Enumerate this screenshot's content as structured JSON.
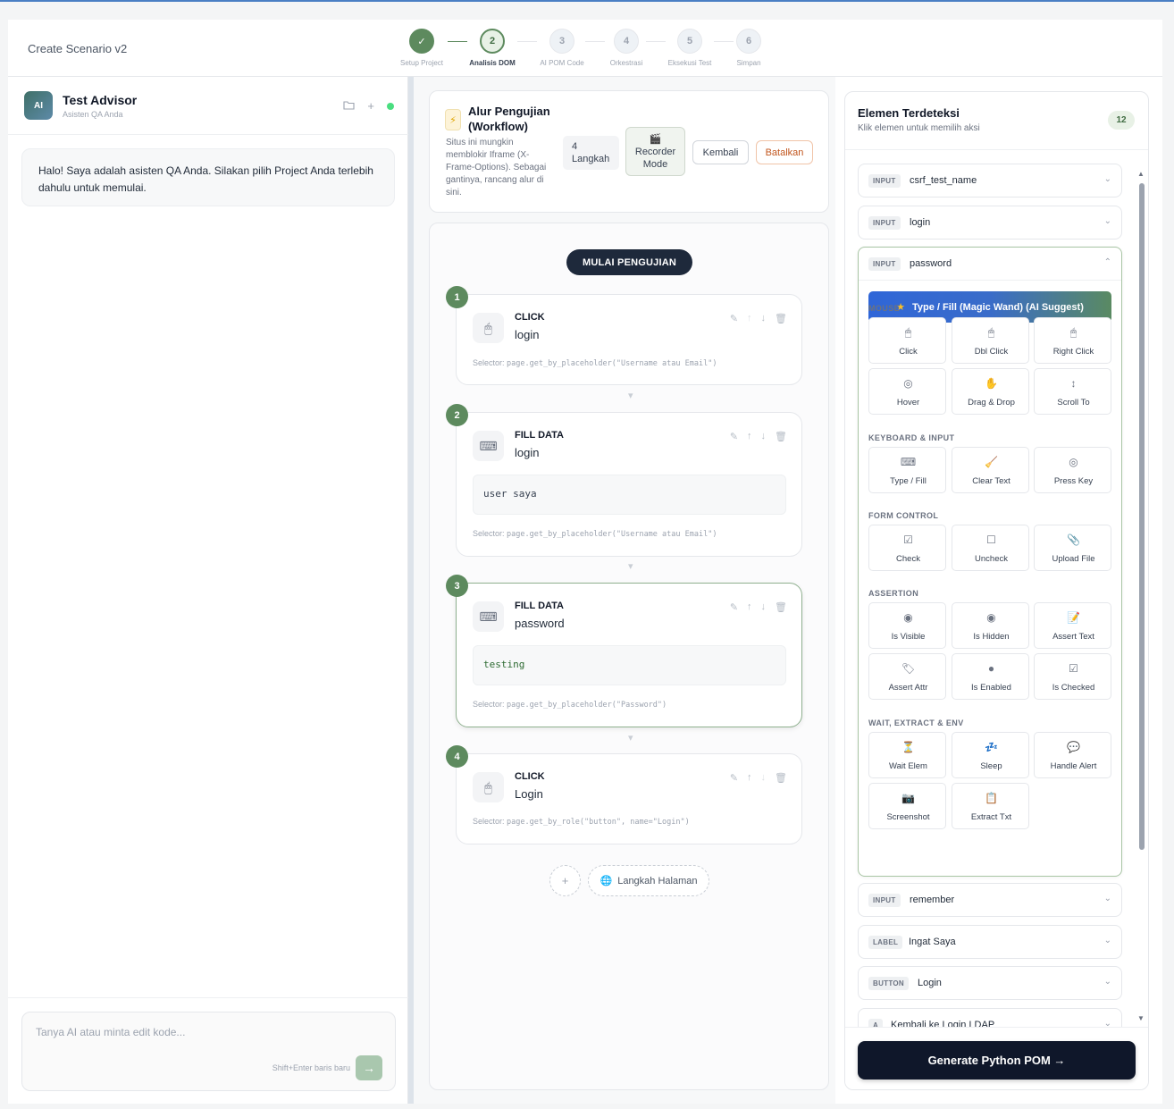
{
  "app": {
    "title": "Create Scenario v2"
  },
  "stepper": [
    {
      "num": "✓",
      "label": "Setup Project",
      "state": "done"
    },
    {
      "num": "2",
      "label": "Analisis DOM",
      "state": "active"
    },
    {
      "num": "3",
      "label": "AI POM Code",
      "state": "todo"
    },
    {
      "num": "4",
      "label": "Orkestrasi",
      "state": "todo"
    },
    {
      "num": "5",
      "label": "Eksekusi Test",
      "state": "todo"
    },
    {
      "num": "6",
      "label": "Simpan",
      "state": "todo"
    }
  ],
  "advisor": {
    "avatar": "AI",
    "name": "Test Advisor",
    "subtitle": "Asisten QA Anda",
    "icons": [
      "folder-icon",
      "plus-icon",
      "online-status-dot"
    ],
    "message": "Halo! Saya adalah asisten QA Anda. Silakan pilih Project Anda terlebih dahulu untuk memulai.",
    "input_placeholder": "Tanya AI atau minta edit kode...",
    "input_hint": "Shift+Enter baris baru"
  },
  "workflow": {
    "title": "Alur Pengujian (Workflow)",
    "description": "Situs ini mungkin memblokir Iframe (X-Frame-Options). Sebagai gantinya, rancang alur di sini.",
    "count": "4 Langkah",
    "recorder_label": "Recorder Mode",
    "back_label": "Kembali",
    "cancel_label": "Batalkan",
    "start_label": "MULAI PENGUJIAN",
    "add_page_label": "Langkah Halaman",
    "steps": [
      {
        "num": "1",
        "type": "CLICK",
        "name": "login",
        "value": null,
        "selector_prefix": "Selector:",
        "selector": "page.get_by_placeholder(\"Username atau Email\")"
      },
      {
        "num": "2",
        "type": "FILL DATA",
        "name": "login",
        "value": "user saya",
        "selector_prefix": "Selector:",
        "selector": "page.get_by_placeholder(\"Username atau Email\")"
      },
      {
        "num": "3",
        "type": "FILL DATA",
        "name": "password",
        "value": "testing",
        "selector_prefix": "Selector:",
        "selector": "page.get_by_placeholder(\"Password\")"
      },
      {
        "num": "4",
        "type": "CLICK",
        "name": "Login",
        "value": null,
        "selector_prefix": "Selector:",
        "selector": "page.get_by_role(\"button\", name=\"Login\")"
      }
    ]
  },
  "elements": {
    "title": "Elemen Terdeteksi",
    "subtitle": "Klik elemen untuk memilih aksi",
    "count": "12",
    "items": [
      {
        "tag": "INPUT",
        "name": "csrf_test_name"
      },
      {
        "tag": "INPUT",
        "name": "login"
      },
      {
        "tag": "INPUT",
        "name": "password"
      },
      {
        "tag": "INPUT",
        "name": "remember"
      },
      {
        "tag": "LABEL",
        "name": "Ingat Saya"
      },
      {
        "tag": "BUTTON",
        "name": "Login"
      },
      {
        "tag": "A",
        "name": "Kembali ke Login LDAP"
      }
    ],
    "magic_label": "Type / Fill (Magic Wand) (AI Suggest)",
    "groups": [
      {
        "title": "MOUSE",
        "actions": [
          {
            "icon": "🖱",
            "label": "Click"
          },
          {
            "icon": "🖱",
            "label": "Dbl Click"
          },
          {
            "icon": "🖱",
            "label": "Right Click"
          },
          {
            "icon": "◎",
            "label": "Hover"
          },
          {
            "icon": "✋",
            "label": "Drag & Drop"
          },
          {
            "icon": "↕",
            "label": "Scroll To"
          }
        ]
      },
      {
        "title": "KEYBOARD & INPUT",
        "actions": [
          {
            "icon": "⌨",
            "label": "Type / Fill"
          },
          {
            "icon": "🧹",
            "label": "Clear Text"
          },
          {
            "icon": "◎",
            "label": "Press Key"
          }
        ]
      },
      {
        "title": "FORM CONTROL",
        "actions": [
          {
            "icon": "☑",
            "label": "Check"
          },
          {
            "icon": "☐",
            "label": "Uncheck"
          },
          {
            "icon": "📎",
            "label": "Upload File"
          }
        ]
      },
      {
        "title": "ASSERTION",
        "actions": [
          {
            "icon": "◉",
            "label": "Is Visible"
          },
          {
            "icon": "◉",
            "label": "Is Hidden"
          },
          {
            "icon": "📝",
            "label": "Assert Text"
          },
          {
            "icon": "🏷",
            "label": "Assert Attr"
          },
          {
            "icon": "●",
            "label": "Is Enabled"
          },
          {
            "icon": "☑",
            "label": "Is Checked"
          }
        ]
      },
      {
        "title": "WAIT, EXTRACT & ENV",
        "actions": [
          {
            "icon": "⏳",
            "label": "Wait Elem"
          },
          {
            "icon": "💤",
            "label": "Sleep"
          },
          {
            "icon": "💬",
            "label": "Handle Alert"
          },
          {
            "icon": "📷",
            "label": "Screenshot"
          },
          {
            "icon": "📋",
            "label": "Extract Txt"
          }
        ]
      }
    ],
    "generate_label": "Generate Python POM →"
  }
}
